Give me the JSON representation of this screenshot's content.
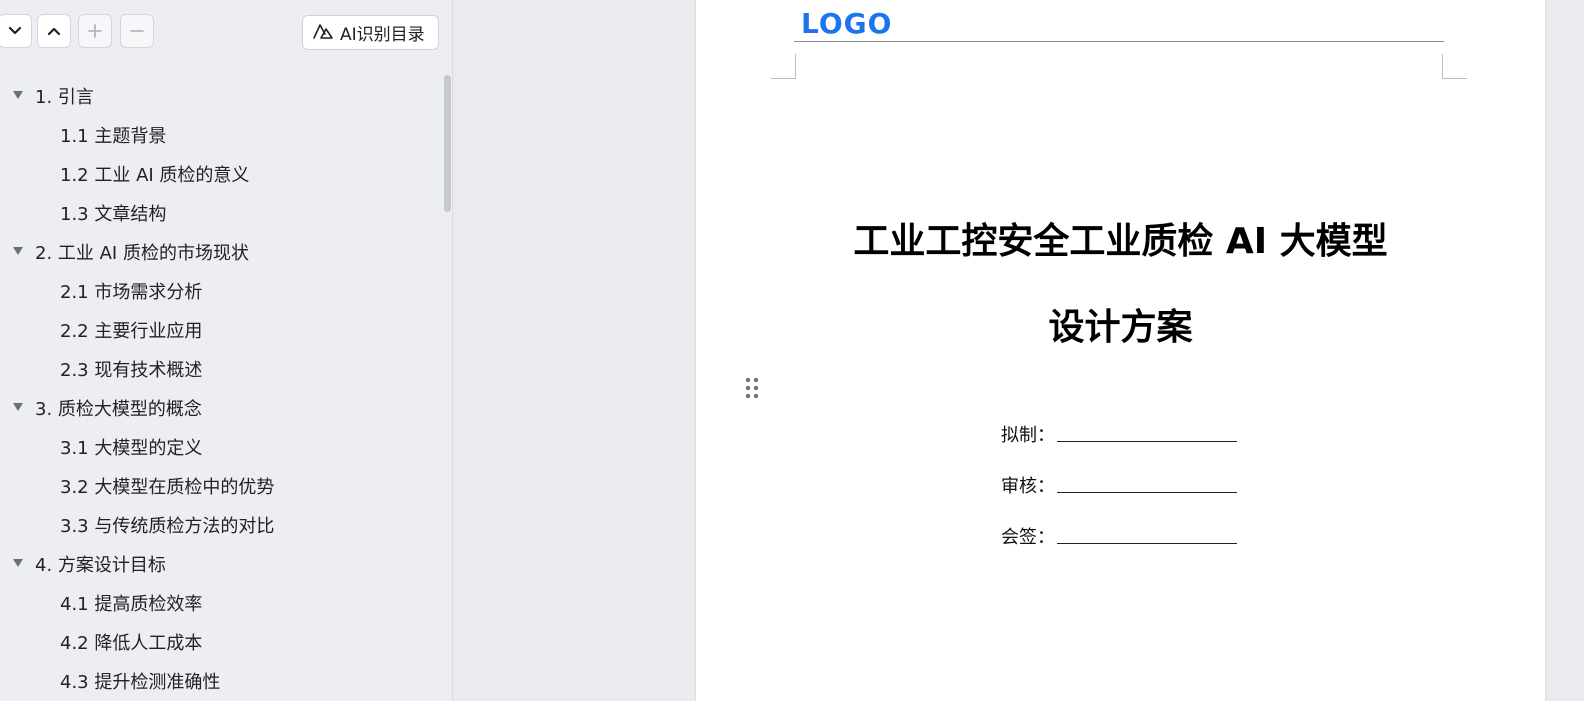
{
  "toolbar": {
    "collapse_icon": "chevron-down-icon",
    "expand_icon": "chevron-up-icon",
    "add_icon": "plus-icon",
    "remove_icon": "minus-icon",
    "ai_button_label": "AI识别目录",
    "ai_button_icon": "ai-icon"
  },
  "outline": {
    "items": [
      {
        "label": "1. 引言",
        "level": 1,
        "expanded": true
      },
      {
        "label": "1.1 主题背景",
        "level": 2
      },
      {
        "label": "1.2 工业 AI 质检的意义",
        "level": 2
      },
      {
        "label": "1.3 文章结构",
        "level": 2
      },
      {
        "label": "2. 工业 AI 质检的市场现状",
        "level": 1,
        "expanded": true
      },
      {
        "label": "2.1 市场需求分析",
        "level": 2
      },
      {
        "label": "2.2 主要行业应用",
        "level": 2
      },
      {
        "label": "2.3 现有技术概述",
        "level": 2
      },
      {
        "label": "3. 质检大模型的概念",
        "level": 1,
        "expanded": true
      },
      {
        "label": "3.1 大模型的定义",
        "level": 2
      },
      {
        "label": "3.2 大模型在质检中的优势",
        "level": 2
      },
      {
        "label": "3.3 与传统质检方法的对比",
        "level": 2
      },
      {
        "label": "4. 方案设计目标",
        "level": 1,
        "expanded": true
      },
      {
        "label": "4.1 提高质检效率",
        "level": 2
      },
      {
        "label": "4.2 降低人工成本",
        "level": 2
      },
      {
        "label": "4.3 提升检测准确性",
        "level": 2
      }
    ]
  },
  "document": {
    "logo_text": "LOGO",
    "logo_color": "#1d74ef",
    "title_line1": "工业工控安全工业质检 AI 大模型",
    "title_line2": "设计方案",
    "signatures": [
      {
        "label": "拟制："
      },
      {
        "label": "审核："
      },
      {
        "label": "会签："
      }
    ]
  }
}
